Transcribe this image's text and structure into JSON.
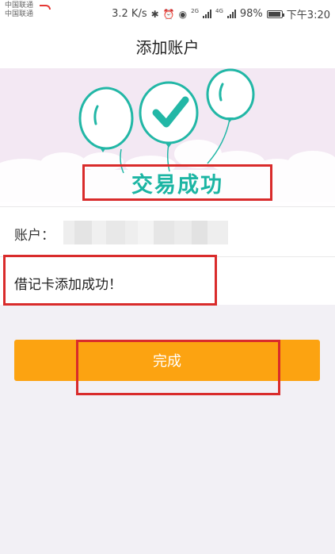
{
  "status_bar": {
    "carrier_1": "中国联通",
    "carrier_2": "中国联通",
    "speed": "3.2 K/s",
    "net_2g": "2G",
    "net_4g": "4G",
    "battery": "98%",
    "time": "下午3:20"
  },
  "header": {
    "title": "添加账户"
  },
  "banner": {
    "success_text": "交易成功"
  },
  "account": {
    "label": "账户："
  },
  "message": {
    "text": "借记卡添加成功！"
  },
  "actions": {
    "finish_label": "完成"
  },
  "colors": {
    "accent": "#fca311",
    "teal": "#1bb5a3",
    "highlight": "#d92b2b"
  }
}
